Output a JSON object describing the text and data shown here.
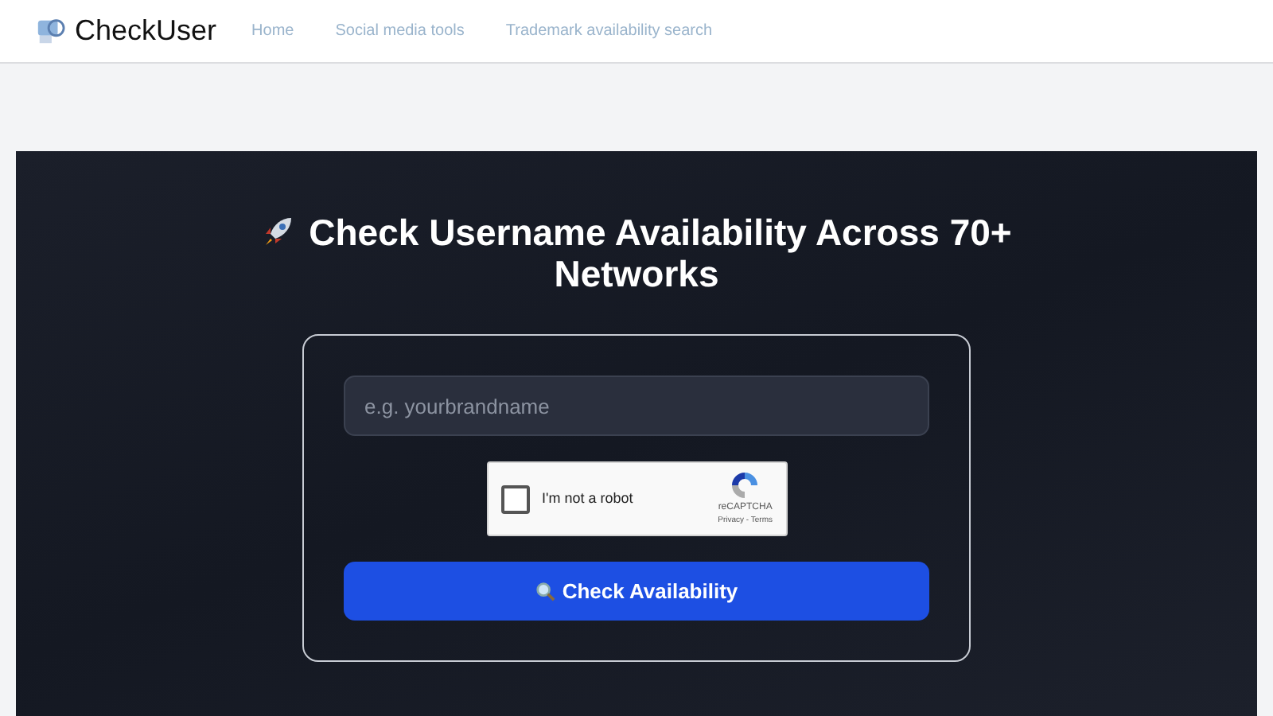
{
  "nav": {
    "brand": "CheckUser",
    "links": [
      {
        "label": "Home"
      },
      {
        "label": "Social media tools"
      },
      {
        "label": "Trademark availability search"
      }
    ]
  },
  "hero": {
    "title": "Check Username Availability Across 70+ Networks",
    "search": {
      "placeholder": "e.g. yourbrandname"
    },
    "captcha": {
      "label": "I'm not a robot",
      "checked": false,
      "brand": "reCAPTCHA",
      "links": "Privacy - Terms"
    },
    "button": "Check Availability"
  }
}
